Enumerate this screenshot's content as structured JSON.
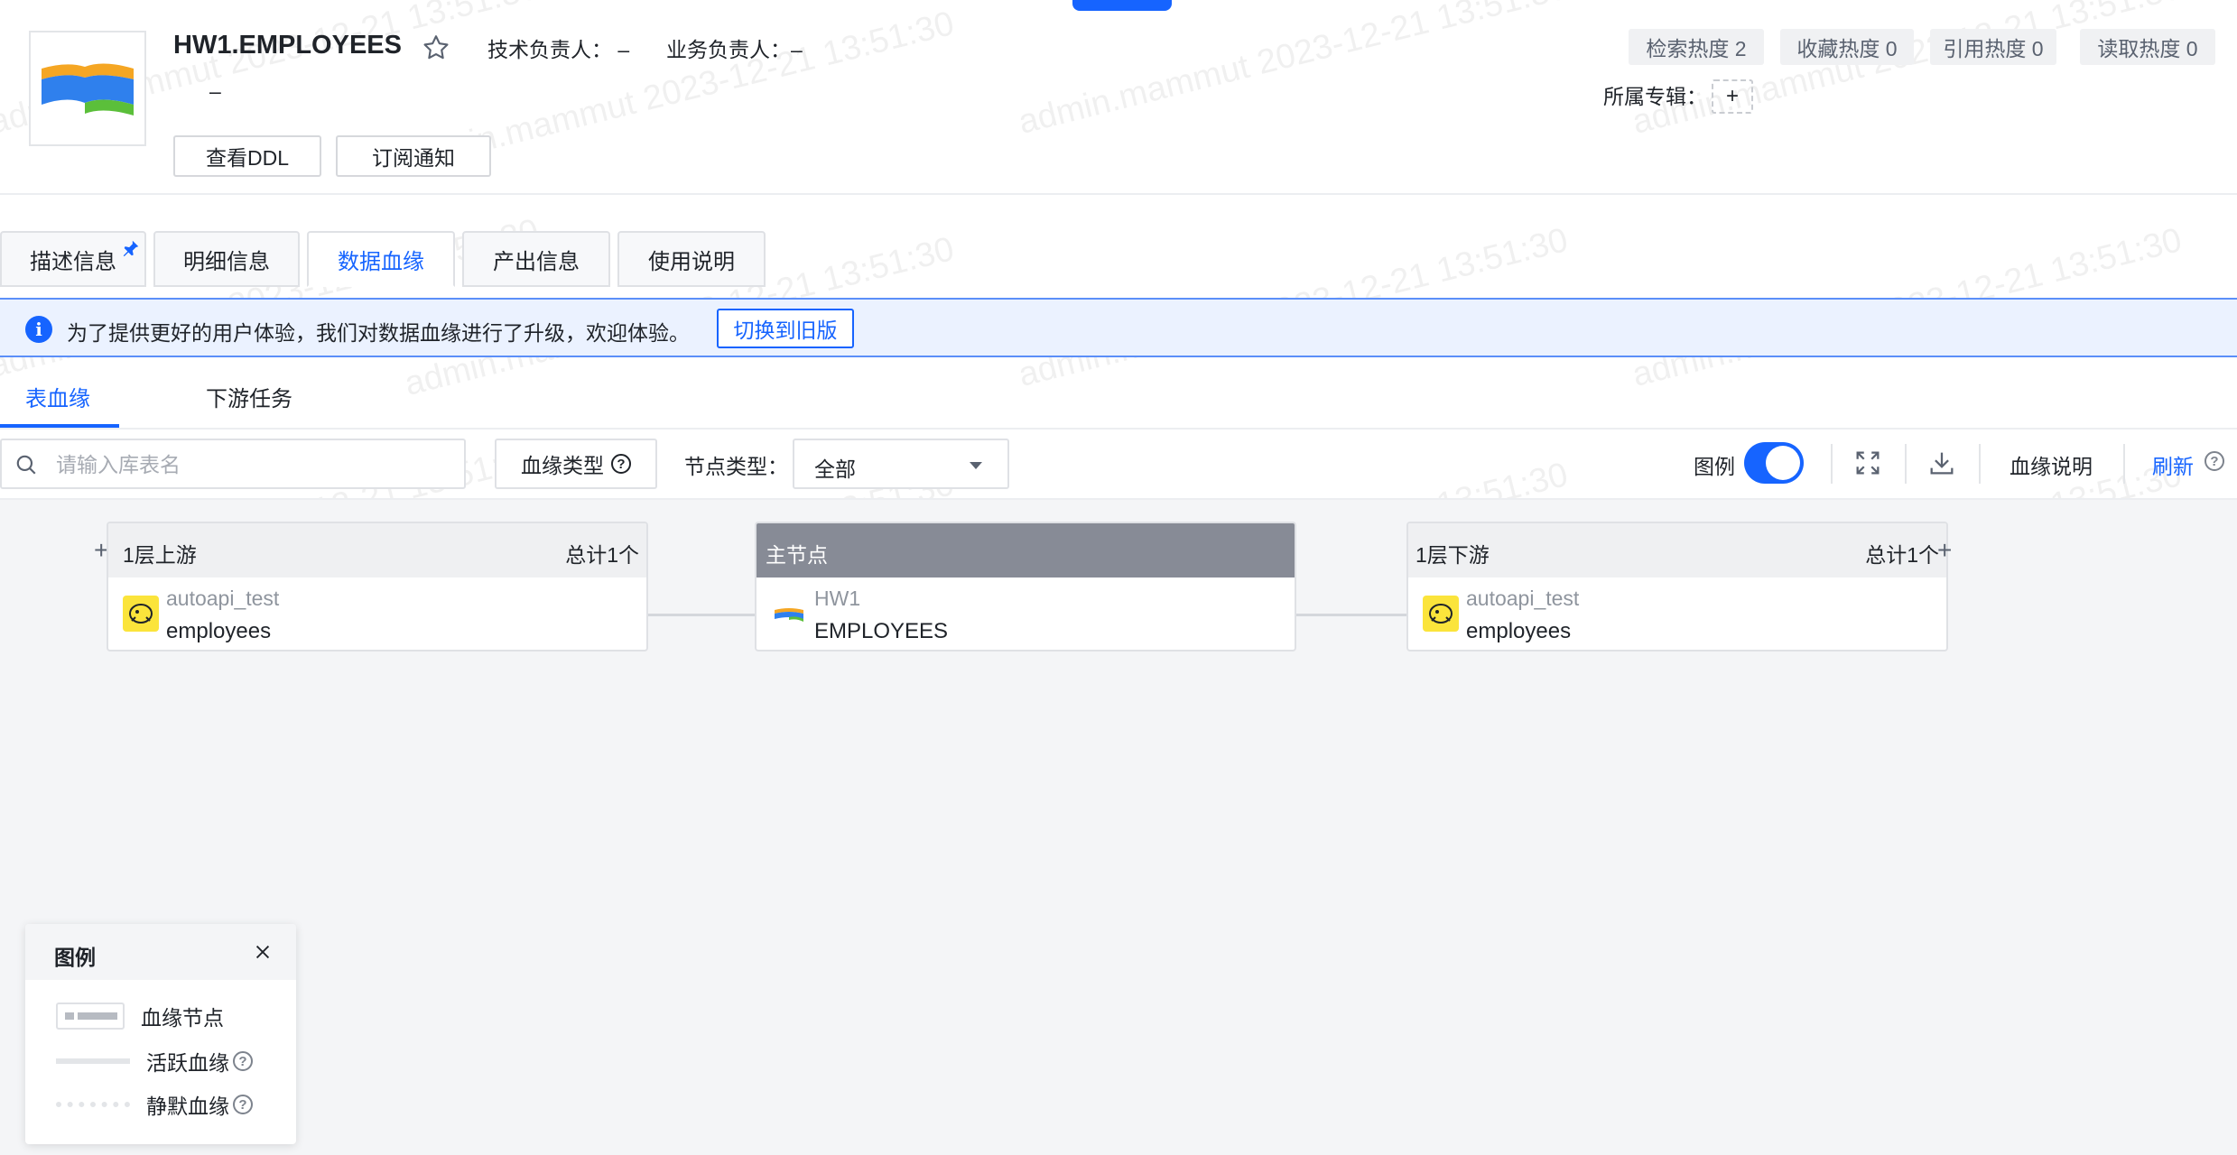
{
  "header": {
    "title": "HW1.EMPLOYEES",
    "tech_owner": "技术负责人：  –",
    "biz_owner": "业务负责人：–",
    "description": "–",
    "btn_ddl": "查看DDL",
    "btn_subscribe": "订阅通知",
    "heat": [
      "检索热度 2",
      "收藏热度 0",
      "引用热度 0",
      "读取热度 0"
    ],
    "album_label": "所属专辑：",
    "album_add": "+"
  },
  "tabs": [
    {
      "label": "描述信息",
      "active": false
    },
    {
      "label": "明细信息",
      "active": false
    },
    {
      "label": "数据血缘",
      "active": true
    },
    {
      "label": "产出信息",
      "active": false
    },
    {
      "label": "使用说明",
      "active": false
    }
  ],
  "notice": {
    "icon": "i",
    "text": "为了提供更好的用户体验，我们对数据血缘进行了升级，欢迎体验。",
    "button": "切换到旧版"
  },
  "subtabs": [
    {
      "label": "表血缘",
      "active": true
    },
    {
      "label": "下游任务",
      "active": false
    }
  ],
  "toolbar": {
    "search_placeholder": "请输入库表名",
    "lineage_type": "血缘类型",
    "node_type_label": "节点类型：",
    "node_type_value": "全部",
    "legend_label": "图例",
    "legend_on": true,
    "lineage_help": "血缘说明",
    "refresh": "刷新"
  },
  "graph": {
    "upstream": {
      "title": "1层上游",
      "count": "总计1个",
      "node": {
        "db": "autoapi_test",
        "table": "employees"
      }
    },
    "main": {
      "title": "主节点",
      "node": {
        "db": "HW1",
        "table": "EMPLOYEES"
      }
    },
    "downstream": {
      "title": "1层下游",
      "count": "总计1个",
      "node": {
        "db": "autoapi_test",
        "table": "employees"
      }
    }
  },
  "legend": {
    "title": "图例",
    "items": [
      "血缘节点",
      "活跃血缘",
      "静默血缘"
    ]
  },
  "watermark": "admin.mammut 2023-12-21 13:51:30",
  "colors": {
    "accent": "#1664ff",
    "main_node_header": "#878b96"
  }
}
